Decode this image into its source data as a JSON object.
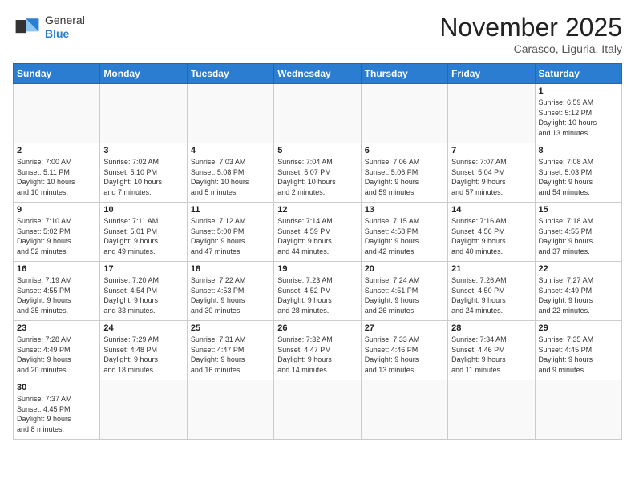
{
  "logo": {
    "line1": "General",
    "line2": "Blue"
  },
  "title": "November 2025",
  "location": "Carasco, Liguria, Italy",
  "days_of_week": [
    "Sunday",
    "Monday",
    "Tuesday",
    "Wednesday",
    "Thursday",
    "Friday",
    "Saturday"
  ],
  "weeks": [
    [
      {
        "day": null,
        "info": null
      },
      {
        "day": null,
        "info": null
      },
      {
        "day": null,
        "info": null
      },
      {
        "day": null,
        "info": null
      },
      {
        "day": null,
        "info": null
      },
      {
        "day": null,
        "info": null
      },
      {
        "day": "1",
        "info": "Sunrise: 6:59 AM\nSunset: 5:12 PM\nDaylight: 10 hours\nand 13 minutes."
      }
    ],
    [
      {
        "day": "2",
        "info": "Sunrise: 7:00 AM\nSunset: 5:11 PM\nDaylight: 10 hours\nand 10 minutes."
      },
      {
        "day": "3",
        "info": "Sunrise: 7:02 AM\nSunset: 5:10 PM\nDaylight: 10 hours\nand 7 minutes."
      },
      {
        "day": "4",
        "info": "Sunrise: 7:03 AM\nSunset: 5:08 PM\nDaylight: 10 hours\nand 5 minutes."
      },
      {
        "day": "5",
        "info": "Sunrise: 7:04 AM\nSunset: 5:07 PM\nDaylight: 10 hours\nand 2 minutes."
      },
      {
        "day": "6",
        "info": "Sunrise: 7:06 AM\nSunset: 5:06 PM\nDaylight: 9 hours\nand 59 minutes."
      },
      {
        "day": "7",
        "info": "Sunrise: 7:07 AM\nSunset: 5:04 PM\nDaylight: 9 hours\nand 57 minutes."
      },
      {
        "day": "8",
        "info": "Sunrise: 7:08 AM\nSunset: 5:03 PM\nDaylight: 9 hours\nand 54 minutes."
      }
    ],
    [
      {
        "day": "9",
        "info": "Sunrise: 7:10 AM\nSunset: 5:02 PM\nDaylight: 9 hours\nand 52 minutes."
      },
      {
        "day": "10",
        "info": "Sunrise: 7:11 AM\nSunset: 5:01 PM\nDaylight: 9 hours\nand 49 minutes."
      },
      {
        "day": "11",
        "info": "Sunrise: 7:12 AM\nSunset: 5:00 PM\nDaylight: 9 hours\nand 47 minutes."
      },
      {
        "day": "12",
        "info": "Sunrise: 7:14 AM\nSunset: 4:59 PM\nDaylight: 9 hours\nand 44 minutes."
      },
      {
        "day": "13",
        "info": "Sunrise: 7:15 AM\nSunset: 4:58 PM\nDaylight: 9 hours\nand 42 minutes."
      },
      {
        "day": "14",
        "info": "Sunrise: 7:16 AM\nSunset: 4:56 PM\nDaylight: 9 hours\nand 40 minutes."
      },
      {
        "day": "15",
        "info": "Sunrise: 7:18 AM\nSunset: 4:55 PM\nDaylight: 9 hours\nand 37 minutes."
      }
    ],
    [
      {
        "day": "16",
        "info": "Sunrise: 7:19 AM\nSunset: 4:55 PM\nDaylight: 9 hours\nand 35 minutes."
      },
      {
        "day": "17",
        "info": "Sunrise: 7:20 AM\nSunset: 4:54 PM\nDaylight: 9 hours\nand 33 minutes."
      },
      {
        "day": "18",
        "info": "Sunrise: 7:22 AM\nSunset: 4:53 PM\nDaylight: 9 hours\nand 30 minutes."
      },
      {
        "day": "19",
        "info": "Sunrise: 7:23 AM\nSunset: 4:52 PM\nDaylight: 9 hours\nand 28 minutes."
      },
      {
        "day": "20",
        "info": "Sunrise: 7:24 AM\nSunset: 4:51 PM\nDaylight: 9 hours\nand 26 minutes."
      },
      {
        "day": "21",
        "info": "Sunrise: 7:26 AM\nSunset: 4:50 PM\nDaylight: 9 hours\nand 24 minutes."
      },
      {
        "day": "22",
        "info": "Sunrise: 7:27 AM\nSunset: 4:49 PM\nDaylight: 9 hours\nand 22 minutes."
      }
    ],
    [
      {
        "day": "23",
        "info": "Sunrise: 7:28 AM\nSunset: 4:49 PM\nDaylight: 9 hours\nand 20 minutes."
      },
      {
        "day": "24",
        "info": "Sunrise: 7:29 AM\nSunset: 4:48 PM\nDaylight: 9 hours\nand 18 minutes."
      },
      {
        "day": "25",
        "info": "Sunrise: 7:31 AM\nSunset: 4:47 PM\nDaylight: 9 hours\nand 16 minutes."
      },
      {
        "day": "26",
        "info": "Sunrise: 7:32 AM\nSunset: 4:47 PM\nDaylight: 9 hours\nand 14 minutes."
      },
      {
        "day": "27",
        "info": "Sunrise: 7:33 AM\nSunset: 4:46 PM\nDaylight: 9 hours\nand 13 minutes."
      },
      {
        "day": "28",
        "info": "Sunrise: 7:34 AM\nSunset: 4:46 PM\nDaylight: 9 hours\nand 11 minutes."
      },
      {
        "day": "29",
        "info": "Sunrise: 7:35 AM\nSunset: 4:45 PM\nDaylight: 9 hours\nand 9 minutes."
      }
    ],
    [
      {
        "day": "30",
        "info": "Sunrise: 7:37 AM\nSunset: 4:45 PM\nDaylight: 9 hours\nand 8 minutes."
      },
      {
        "day": null,
        "info": null
      },
      {
        "day": null,
        "info": null
      },
      {
        "day": null,
        "info": null
      },
      {
        "day": null,
        "info": null
      },
      {
        "day": null,
        "info": null
      },
      {
        "day": null,
        "info": null
      }
    ]
  ]
}
